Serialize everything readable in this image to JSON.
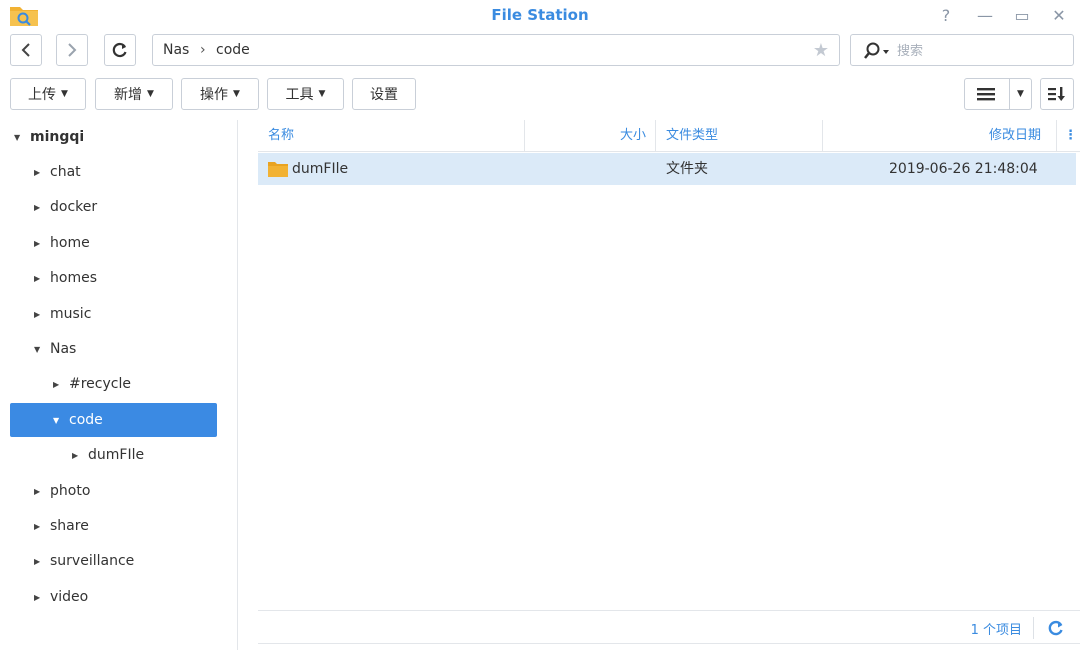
{
  "window": {
    "title": "File Station",
    "controls": {
      "help": "?",
      "minimize": "—",
      "maximize": "▭",
      "close": "✕"
    }
  },
  "nav": {
    "path": [
      "Nas",
      "code"
    ],
    "path_separator": "›",
    "search_placeholder": "搜索"
  },
  "toolbar": {
    "upload": "上传",
    "create": "新增",
    "action": "操作",
    "tools": "工具",
    "settings": "设置"
  },
  "sidebar": {
    "root": "mingqi",
    "items": [
      {
        "label": "chat",
        "level": 1,
        "expanded": false
      },
      {
        "label": "docker",
        "level": 1,
        "expanded": false
      },
      {
        "label": "home",
        "level": 1,
        "expanded": false
      },
      {
        "label": "homes",
        "level": 1,
        "expanded": false
      },
      {
        "label": "music",
        "level": 1,
        "expanded": false
      },
      {
        "label": "Nas",
        "level": 1,
        "expanded": true
      },
      {
        "label": "#recycle",
        "level": 2,
        "expanded": false
      },
      {
        "label": "code",
        "level": 2,
        "expanded": true,
        "selected": true
      },
      {
        "label": "dumFIle",
        "level": 3,
        "expanded": false
      },
      {
        "label": "photo",
        "level": 1,
        "expanded": false
      },
      {
        "label": "share",
        "level": 1,
        "expanded": false
      },
      {
        "label": "surveillance",
        "level": 1,
        "expanded": false
      },
      {
        "label": "video",
        "level": 1,
        "expanded": false
      }
    ]
  },
  "table": {
    "columns": {
      "name": "名称",
      "size": "大小",
      "type": "文件类型",
      "modified": "修改日期"
    },
    "rows": [
      {
        "name": "dumFIle",
        "size": "",
        "type": "文件夹",
        "modified": "2019-06-26 21:48:04"
      }
    ]
  },
  "footer": {
    "count": "1 个项目"
  },
  "colors": {
    "accent": "#3a8be0",
    "selection": "#3b8ae3",
    "row_highlight": "#dbeaf8",
    "folder": "#f2b233"
  }
}
